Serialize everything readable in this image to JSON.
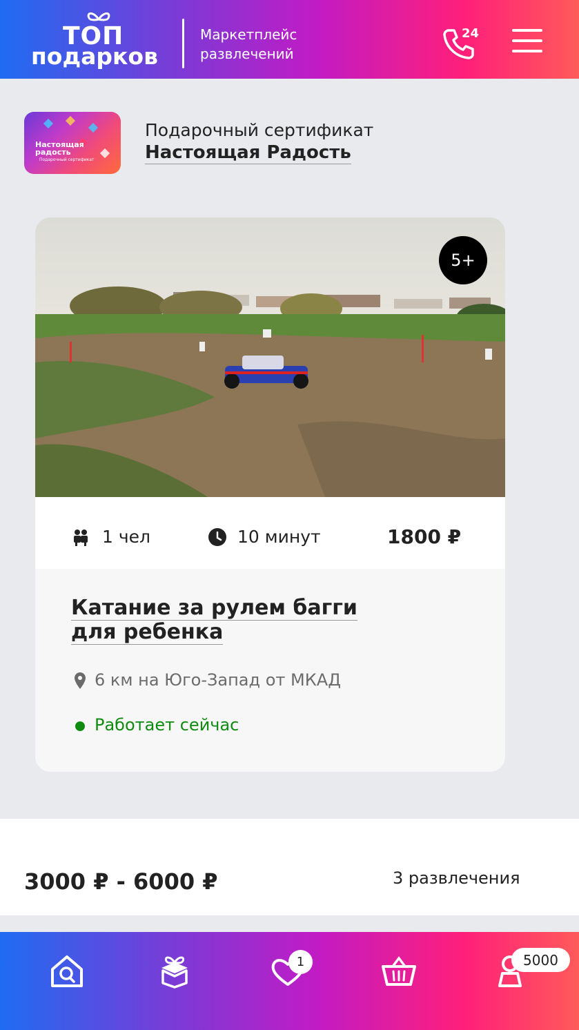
{
  "header": {
    "logo_line1": "ТОП",
    "logo_line2": "подарков",
    "tagline_line1": "Маркетплейс",
    "tagline_line2": "развлечений",
    "phone_badge": "24"
  },
  "certificate": {
    "image_title": "Настоящая радость",
    "image_subtitle": "Подарочный сертификат",
    "line1": "Подарочный сертификат",
    "line2": "Настоящая Радость"
  },
  "card": {
    "age_badge": "5+",
    "people": "1 чел",
    "duration": "10 минут",
    "price": "1800 ₽",
    "title_line1": "Катание за рулем багги",
    "title_line2": "для ребенка",
    "location": "6 км на Юго-Запад от МКАД",
    "status": "Работает сейчас"
  },
  "range": {
    "price": "3000 ₽ - 6000 ₽",
    "count": "3 развлечения"
  },
  "bottom_nav": {
    "favorites_badge": "1",
    "balance_badge": "5000",
    "items": [
      "home-search-icon",
      "gift-icon",
      "heart-icon",
      "basket-icon",
      "profile-icon"
    ]
  },
  "colors": {
    "gradient_start": "#1f6cf2",
    "gradient_mid": "#c21bc4",
    "gradient_end": "#ff5a5a",
    "status_green": "#0f8c0f",
    "page_bg": "#e9eaee"
  }
}
